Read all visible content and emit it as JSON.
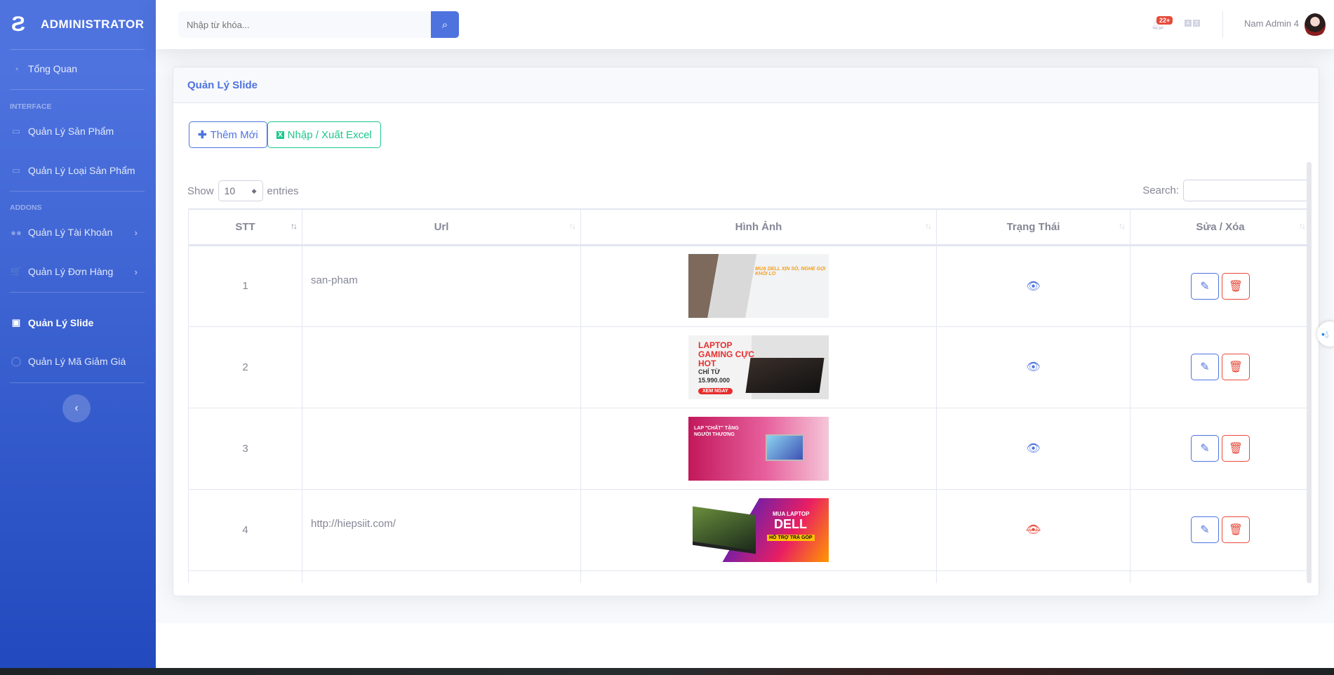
{
  "sidebar": {
    "brand": "ADMINISTRATOR",
    "sections": {
      "interface": "INTERFACE",
      "addons": "ADDONS"
    },
    "items": [
      {
        "label": "Tổng Quan",
        "icon": "tachometer-icon"
      },
      {
        "label": "Quản Lý Sản Phẩm",
        "icon": "laptop-icon"
      },
      {
        "label": "Quản Lý Loại Sản Phẩm",
        "icon": "laptop-code-icon"
      },
      {
        "label": "Quản Lý Tài Khoản",
        "icon": "users-cog-icon"
      },
      {
        "label": "Quản Lý Đơn Hàng",
        "icon": "cart-icon"
      },
      {
        "label": "Quản Lý Slide",
        "icon": "slideshow-icon",
        "active": true
      },
      {
        "label": "Quản Lý Mã Giảm Giá",
        "icon": "comment-icon"
      }
    ]
  },
  "topbar": {
    "search_placeholder": "Nhập từ khóa...",
    "notif_badge": "22+",
    "user_name": "Nam Admin 4"
  },
  "card": {
    "title": "Quản Lý Slide",
    "add_label": "Thêm Mới",
    "excel_label": "Nhập / Xuất Excel"
  },
  "table": {
    "show": "Show",
    "entries_value": "10",
    "entries": "entries",
    "search_label": "Search:",
    "columns": [
      "STT",
      "Url",
      "Hình Ảnh",
      "Trạng Thái",
      "Sửa / Xóa"
    ],
    "rows": [
      {
        "stt": "1",
        "url": "san-pham",
        "visible": true
      },
      {
        "stt": "2",
        "url": "",
        "visible": true
      },
      {
        "stt": "3",
        "url": "",
        "visible": true
      },
      {
        "stt": "4",
        "url": "http://hiepsiit.com/",
        "visible": false
      }
    ]
  },
  "banners": {
    "b1": "MUA DELL XỊN SÒ, NGHE GỌI KHỎI LO",
    "b2_title": "LAPTOP GAMING CỰC HOT",
    "b2_price_label": "CHỈ TỪ",
    "b2_price": "15.990.000",
    "b2_cta": "XEM NGAY",
    "b3": "LAP \"CHẤT\" TẶNG NGƯỜI THƯƠNG",
    "b4_top": "MUA LAPTOP",
    "b4_brand": "DELL",
    "b4_sub": "HỖ TRỢ TRẢ GÓP"
  },
  "colors": {
    "primary": "#4e73df",
    "success": "#1cc88a",
    "danger": "#e74a3b"
  }
}
